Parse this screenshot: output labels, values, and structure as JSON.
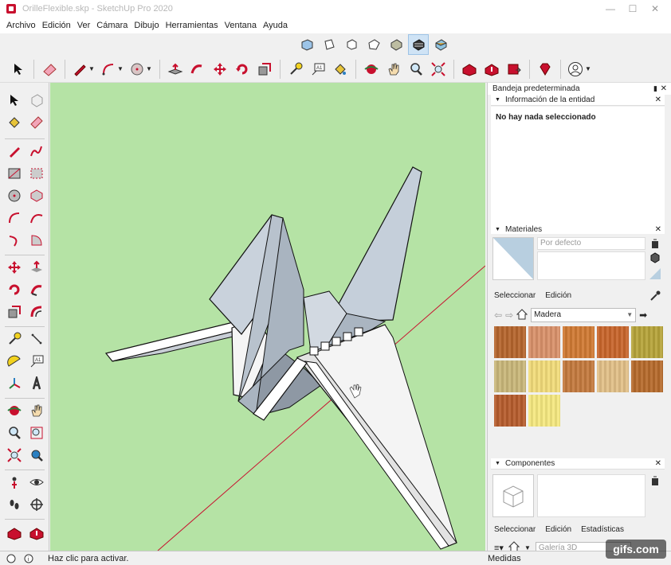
{
  "window": {
    "title": "OrilleFlexible.skp - SketchUp Pro 2020",
    "min": "—",
    "max": "☐",
    "close": "✕"
  },
  "menu": [
    "Archivo",
    "Edición",
    "Ver",
    "Cámara",
    "Dibujo",
    "Herramientas",
    "Ventana",
    "Ayuda"
  ],
  "tray": {
    "title": "Bandeja predeterminada",
    "pin": "▮",
    "close": "✕",
    "entity": {
      "header": "Información de la entidad",
      "message": "No hay nada seleccionado"
    },
    "materials": {
      "header": "Materiales",
      "name": "Por defecto",
      "tabs": [
        "Seleccionar",
        "Edición"
      ],
      "library": "Madera",
      "swatch_colors": [
        "#b5652d",
        "#d9916a",
        "#d07a33",
        "#c8652b",
        "#b6a43a",
        "#c9b77a",
        "#f2dc7a",
        "#c47a3e",
        "#e2c088",
        "#b66a2c",
        "#b65c2d",
        "#f5e880"
      ]
    },
    "components": {
      "header": "Componentes",
      "tabs": [
        "Seleccionar",
        "Edición",
        "Estadísticas"
      ],
      "search": "Galería 3D"
    }
  },
  "status": {
    "message": "Haz clic para activar.",
    "measure_label": "Medidas"
  },
  "watermark": "gifs.com"
}
